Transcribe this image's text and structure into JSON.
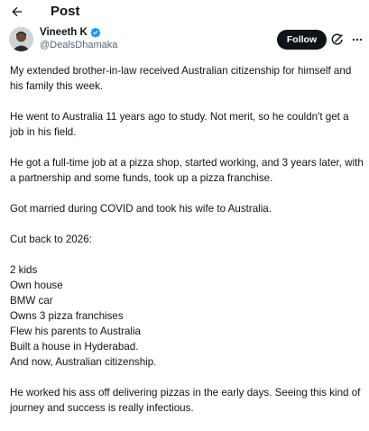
{
  "header": {
    "back_icon": "arrow-left-icon",
    "title": "Post"
  },
  "author": {
    "display_name": "Vineeth K",
    "handle": "@DealsDhamaka",
    "verified_color": "#1d9bf0",
    "follow_label": "Follow"
  },
  "post": {
    "paragraphs": [
      "My extended brother-in-law received Australian citizenship for himself and his family this week.",
      "He went to Australia 11 years ago to study. Not merit, so he couldn't get a job in his field.",
      "He got a full-time job at a pizza shop, started working, and 3 years later, with a partnership and some funds, took up a pizza franchise.",
      "Got married during COVID and took his wife to Australia.",
      "Cut back to 2026:"
    ],
    "list": [
      "2 kids",
      "Own house",
      "BMW car",
      "Owns 3 pizza franchises",
      "Flew his parents to Australia",
      "Built a house in Hyderabad.",
      "And now, Australian citizenship."
    ],
    "closing": "He worked his ass off delivering pizzas in the early days. Seeing this kind of journey and success is really infectious."
  }
}
